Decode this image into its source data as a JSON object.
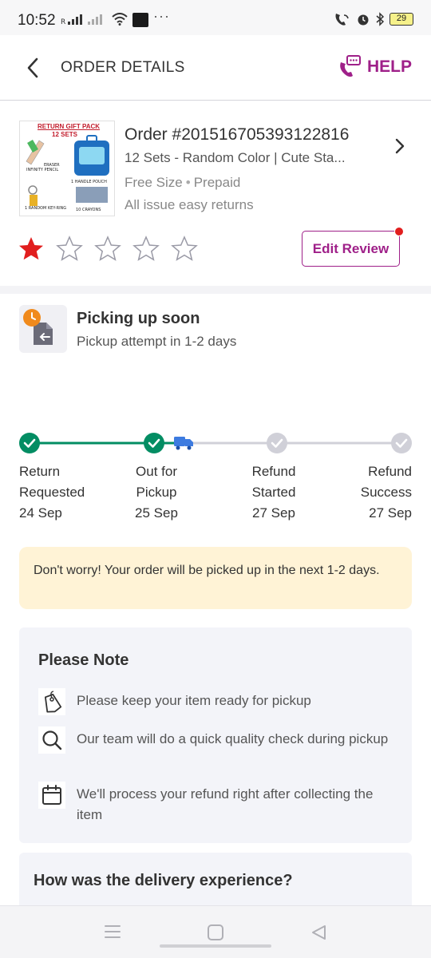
{
  "statusbar": {
    "time": "10:52",
    "battery": "29"
  },
  "header": {
    "title": "ORDER DETAILS",
    "help_label": "HELP"
  },
  "product": {
    "image_title": "RETURN GIFT PACK",
    "image_subtitle": "12 SETS",
    "image_labels": [
      "ERASER",
      "INFINITY PENCIL",
      "1 HANDLE POUCH",
      "1 RANDOM KEY-RING",
      "10 CRAYONS"
    ],
    "order_id": "Order #201516705393122816",
    "name": "12 Sets - Random Color | Cute Sta...",
    "size": "Free Size",
    "payment": "Prepaid",
    "returns": "All issue easy returns",
    "rating": 1,
    "max_rating": 5,
    "edit_review_label": "Edit Review"
  },
  "status": {
    "title": "Picking up soon",
    "subtitle": "Pickup attempt in 1-2 days"
  },
  "tracker": {
    "steps": [
      {
        "line1": "Return",
        "line2": "Requested",
        "date": "24 Sep",
        "done": true
      },
      {
        "line1": "Out for",
        "line2": "Pickup",
        "date": "25 Sep",
        "done": true
      },
      {
        "line1": "Refund",
        "line2": "Started",
        "date": "27 Sep",
        "done": false
      },
      {
        "line1": "Refund",
        "line2": "Success",
        "date": "27 Sep",
        "done": false
      }
    ]
  },
  "info_message": "Don't worry! Your order will be picked up in the next 1-2 days.",
  "note": {
    "title": "Please Note",
    "items": [
      {
        "icon": "tag-icon",
        "text": "Please keep your item ready for pickup"
      },
      {
        "icon": "search-icon",
        "text": "Our team will do a quick quality check during pickup"
      },
      {
        "icon": "calendar-icon",
        "text": "We'll process your refund right after collecting the item"
      }
    ]
  },
  "delivery": {
    "title": "How was the delivery experience?"
  },
  "colors": {
    "brand": "#9f2089",
    "success": "#038d63",
    "star_filled": "#e11e1e",
    "info_bg": "#fff3d6",
    "note_bg": "#f3f4f9"
  }
}
